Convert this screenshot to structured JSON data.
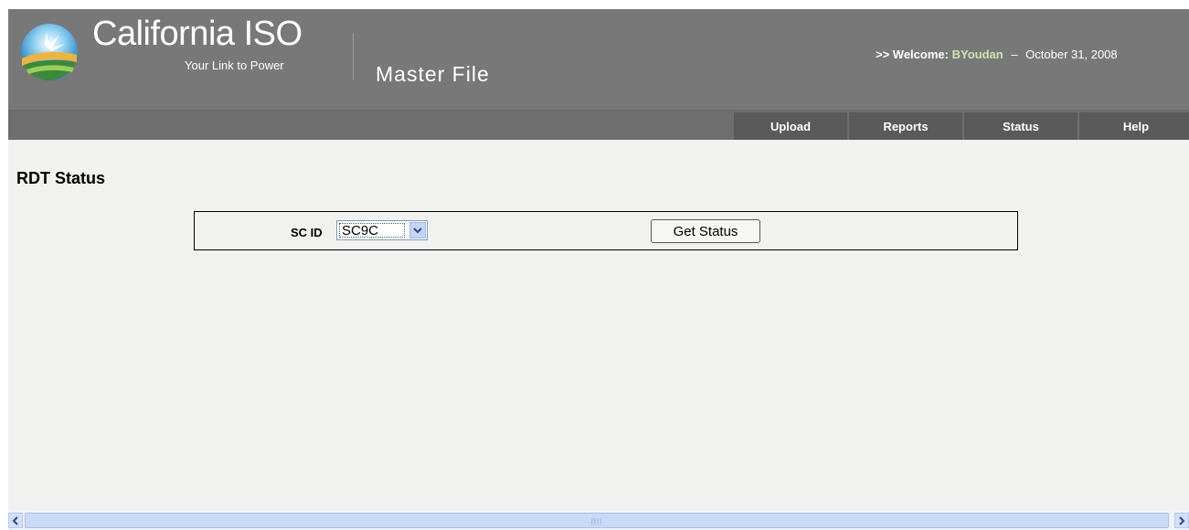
{
  "header": {
    "brand_name": "California ISO",
    "tagline": "Your Link to Power",
    "app_title": "Master File",
    "welcome_prefix": ">> Welcome:",
    "username": "BYoudan",
    "separator": "–",
    "date": "October 31, 2008",
    "colors": {
      "header_bg": "#787878",
      "tab_bg": "#5a5a5a",
      "username": "#cfe3b0"
    }
  },
  "nav": {
    "tabs": [
      {
        "label": "Upload"
      },
      {
        "label": "Reports"
      },
      {
        "label": "Status"
      },
      {
        "label": "Help"
      }
    ]
  },
  "main": {
    "page_title": "RDT Status",
    "sc_id_label": "SC ID",
    "sc_id_value": "SC9C",
    "get_status_label": "Get Status"
  },
  "icons": {
    "logo": "california-iso-logo",
    "dropdown": "chevron-down-icon",
    "scroll_left": "scroll-left-arrow-icon",
    "scroll_right": "scroll-right-arrow-icon"
  }
}
